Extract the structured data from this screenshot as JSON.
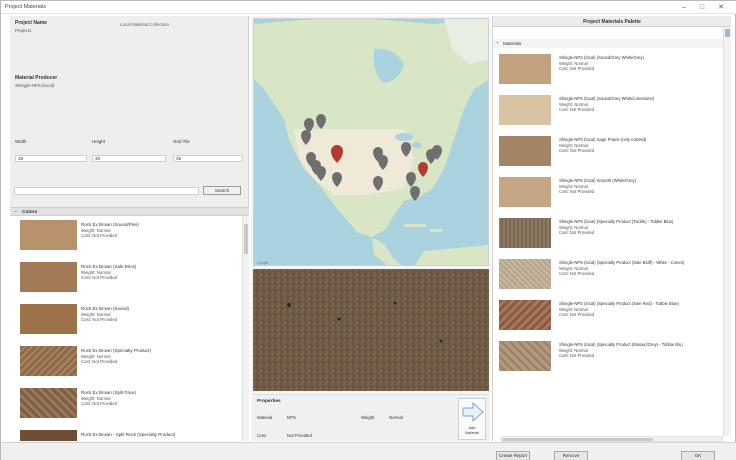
{
  "window": {
    "title": "Project Materials",
    "minimize": "–",
    "maximize": "□",
    "close": "✕"
  },
  "left": {
    "project_name_label": "Project Name",
    "project_name_value": "Project1",
    "top_right_text": "Local Material Collection",
    "material_label": "Material Producer",
    "material_value": "Shingle-NPS (local)",
    "width_label": "Width",
    "height_label": "Height",
    "grid_label": "Grid Tile",
    "width_value": "38",
    "height_value": "38",
    "grid_value": "38",
    "search_placeholder": "",
    "search_btn": "Search",
    "colors_header": "Colors",
    "items": [
      {
        "name": "Rock Ex Brown (Sound/Flex)",
        "l2": "Weight: Normal",
        "l3": "Cost: Not Provided",
        "color": "#b8926a"
      },
      {
        "name": "Rock Ex Brown (Sale Brick)",
        "l2": "Weight: Normal",
        "l3": "Cost: Not Provided",
        "color": "#a27a55"
      },
      {
        "name": "Rock Ex Brown (Sound)",
        "l2": "Weight: Normal",
        "l3": "Cost: Not Provided",
        "color": "#9c7248"
      },
      {
        "name": "Rock Ex Brown (Specialty Product)",
        "l2": "Weight: Normal",
        "l3": "Cost: Not Provided",
        "color": "#8e6a48"
      },
      {
        "name": "Rock Ex Brown (Split Face)",
        "l2": "Weight: Normal",
        "l3": "Cost: Not Provided",
        "color": "#7e5f44"
      },
      {
        "name": "Rock Ex Brown - Split Rock (Specialty Product)",
        "l2": "",
        "l3": "",
        "color": "#6e4e36"
      }
    ]
  },
  "center": {
    "props_title": "Properties",
    "props_row1_k": "Material",
    "props_row1_v": "NPS",
    "props_row1_k2": "Weight",
    "props_row1_v2": "Normal",
    "props_row2_k": "Cost",
    "props_row2_v": "Not Provided",
    "apply_label": "Add\nMaterial"
  },
  "right": {
    "header": "Project Materials Palette",
    "sub": "Materials",
    "items": [
      {
        "name": "Shingle-NPS (local) (Sound/Grey White/Grey)",
        "l2": "Weight: Normal",
        "l3": "Cost: Not Provided",
        "color": "#c2a27c"
      },
      {
        "name": "Shingle-NPS (local) (Sound/Grey White/Limestone)",
        "l2": "Weight: Normal",
        "l3": "Cost: Not Provided",
        "color": "#d8c3a2"
      },
      {
        "name": "Shingle-NPS (local) Sage Prairie (only colored)",
        "l2": "Weight: Normal",
        "l3": "Cost: Not Provided",
        "color": "#a38464"
      },
      {
        "name": "Shingle-NPS (local) Smooth (White/Grey)",
        "l2": "Weight: Normal",
        "l3": "Cost: Not Provided",
        "color": "#c4a684"
      },
      {
        "name": "Shingle-NPS (local) (Specialty Product (Tactile) - Tobbie Blue)",
        "l2": "Weight: Normal",
        "l3": "Cost: Not Provided",
        "color": "#8c7a62"
      },
      {
        "name": "Shingle-NPS (local) (Specialty Product (Sale Bluff) - White - Comm)",
        "l2": "Weight: Normal",
        "l3": "Cost: Not Provided",
        "color": "#c8b8a2"
      },
      {
        "name": "Shingle-NPS (local) (Specialty Product (Sale Red) - Tobbie Blue)",
        "l2": "Weight: Normal",
        "l3": "Cost: Not Provided",
        "color": "#8a5c44"
      },
      {
        "name": "Shingle-NPS (local) (Specialty Product (Mosaic/Grey) - Tobbie Blu)",
        "l2": "Weight: Normal",
        "l3": "Cost: Not Provided",
        "color": "#b39a7e"
      }
    ]
  },
  "bottom": {
    "btn1": "Create Report",
    "btn2": "Remove",
    "btn3": "OK"
  },
  "colors": {
    "water": "#aad3df",
    "land": "#d8e6c6",
    "land2": "#efe9d8",
    "pin": "#6f6f6f",
    "pin_sel": "#b33a2e"
  }
}
